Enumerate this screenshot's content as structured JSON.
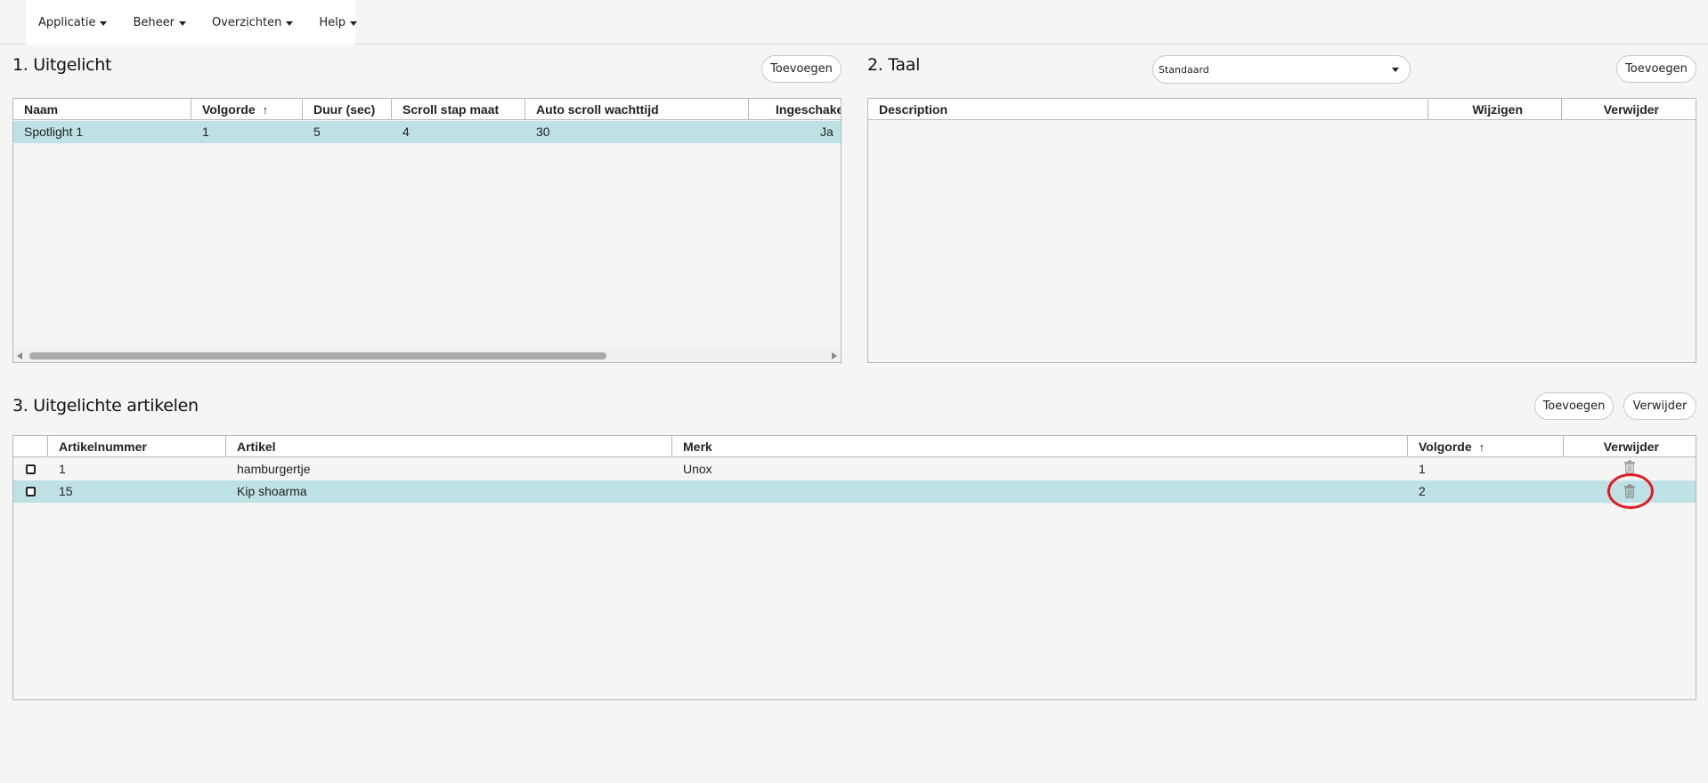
{
  "nav": {
    "items": [
      {
        "label": "Applicatie"
      },
      {
        "label": "Beheer"
      },
      {
        "label": "Overzichten"
      },
      {
        "label": "Help"
      }
    ]
  },
  "uitgelicht": {
    "title": "1. Uitgelicht",
    "add_label": "Toevoegen",
    "columns": [
      "Naam",
      "Volgorde",
      "Duur (sec)",
      "Scroll stap maat",
      "Auto scroll wachttijd",
      "Ingeschakeld"
    ],
    "sort_column": "Volgorde",
    "rows": [
      {
        "naam": "Spotlight 1",
        "volgorde": "1",
        "duur": "5",
        "scroll_stap": "4",
        "wachttijd": "30",
        "ingeschakeld": "Ja"
      }
    ],
    "scroll_position": 0.0
  },
  "taal": {
    "title": "2. Taal",
    "selected_option": "Standaard",
    "add_label": "Toevoegen",
    "columns": [
      "Description",
      "Wijzigen",
      "Verwijder"
    ],
    "rows": []
  },
  "artikelen": {
    "title": "3. Uitgelichte artikelen",
    "add_label": "Toevoegen",
    "remove_label": "Verwijder",
    "columns": [
      "Artikelnummer",
      "Artikel",
      "Merk",
      "Volgorde",
      "Verwijder"
    ],
    "sort_column": "Volgorde",
    "rows": [
      {
        "nummer": "1",
        "artikel": "hamburgertje",
        "merk": "Unox",
        "volgorde": "1",
        "checked": false,
        "selected": false
      },
      {
        "nummer": "15",
        "artikel": "Kip shoarma",
        "merk": "",
        "volgorde": "2",
        "checked": false,
        "selected": true
      }
    ]
  },
  "colors": {
    "selected_row": "#bde1e5",
    "highlight": "#e01b24",
    "background": "#f5f5f4"
  },
  "icons": {
    "sort": "arrow-up-icon",
    "delete": "trash-icon",
    "dropdown": "caret-down-icon"
  }
}
